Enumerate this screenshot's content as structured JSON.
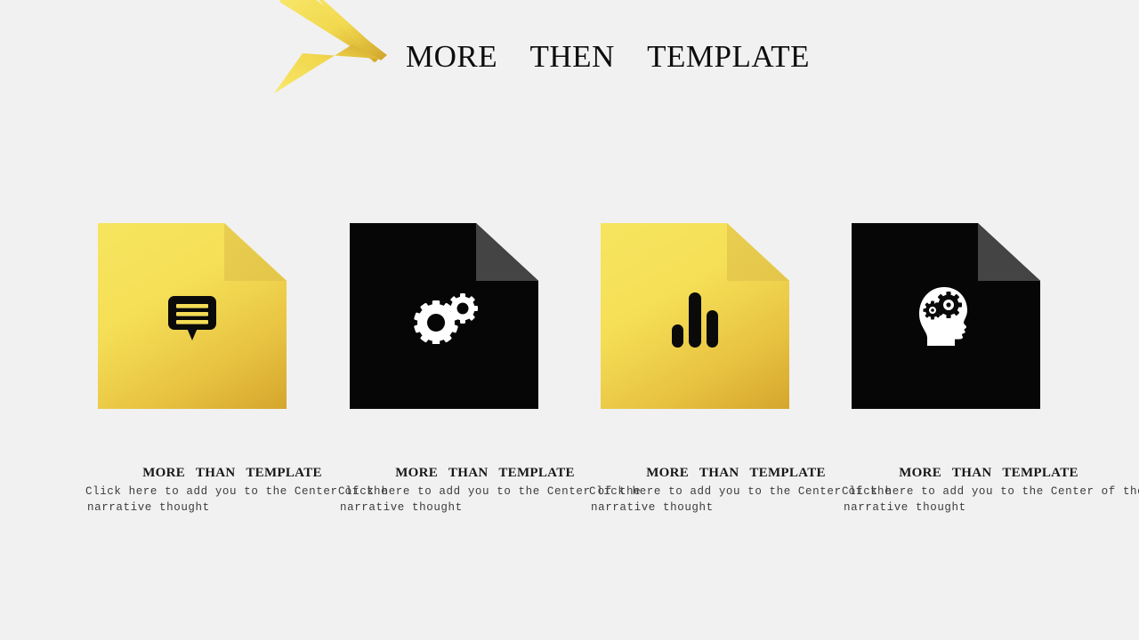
{
  "page": {
    "background_color": "#f1f1f1",
    "title": "MORE    THEN    TEMPLATE"
  },
  "header": {
    "title": "MORE    THEN    TEMPLATE",
    "decoration": {
      "name": "arrow-accent",
      "color_light": "#f7e45f",
      "color_dark": "#d9b238"
    }
  },
  "cards": [
    {
      "id": "card-1",
      "style": "yellow",
      "background_color": "#f5df57",
      "fold_color": "#e5c94c",
      "icon": "speech-bubble-icon",
      "icon_color": "#0a0a0a",
      "heading": "MORE   THAN   TEMPLATE",
      "body_line1": "Click here to add  you to the Center of the",
      "body_line2": "narrative thought"
    },
    {
      "id": "card-2",
      "style": "dark",
      "background_color": "#060606",
      "fold_color": "#444444",
      "icon": "gears-icon",
      "icon_color": "#ffffff",
      "heading": "MORE   THAN   TEMPLATE",
      "body_line1": "Click here to add  you to the Center of the",
      "body_line2": "narrative thought"
    },
    {
      "id": "card-3",
      "style": "yellow",
      "background_color": "#f5df57",
      "fold_color": "#e5c94c",
      "icon": "bar-chart-icon",
      "icon_color": "#0a0a0a",
      "heading": "MORE   THAN   TEMPLATE",
      "body_line1": "Click here to add  you to the Center of the",
      "body_line2": "narrative thought"
    },
    {
      "id": "card-4",
      "style": "dark",
      "background_color": "#060606",
      "fold_color": "#444444",
      "icon": "head-gears-icon",
      "icon_color": "#ffffff",
      "heading": "MORE   THAN   TEMPLATE",
      "body_line1": "Click here to add  you to the Center of the",
      "body_line2": "narrative thought"
    }
  ]
}
